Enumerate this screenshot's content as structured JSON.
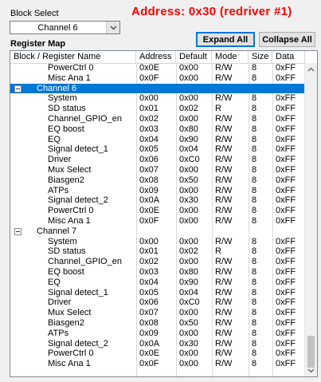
{
  "block_select": {
    "label": "Block Select",
    "value": "Channel 6"
  },
  "address_title": "Address:  0x30 (redriver #1)",
  "register_map_label": "Register Map",
  "buttons": {
    "expand_all": "Expand All",
    "collapse_all": "Collapse All"
  },
  "columns": [
    "Block / Register Name",
    "Address",
    "Default",
    "Mode",
    "Size",
    "Data"
  ],
  "rows": [
    {
      "name": "PowerCtrl 0",
      "address": "0x0E",
      "default": "0x00",
      "mode": "R/W",
      "size": "8",
      "data": "0xFF",
      "level": 1
    },
    {
      "name": "Misc Ana 1",
      "address": "0x0F",
      "default": "0x00",
      "mode": "R/W",
      "size": "8",
      "data": "0xFF",
      "level": 1
    },
    {
      "name": "Channel 6",
      "level": 0,
      "selected": true
    },
    {
      "name": "System",
      "address": "0x00",
      "default": "0x00",
      "mode": "R/W",
      "size": "8",
      "data": "0xFF",
      "level": 1
    },
    {
      "name": "SD status",
      "address": "0x01",
      "default": "0x02",
      "mode": "R",
      "size": "8",
      "data": "0xFF",
      "level": 1
    },
    {
      "name": "Channel_GPIO_en",
      "address": "0x02",
      "default": "0x00",
      "mode": "R/W",
      "size": "8",
      "data": "0xFF",
      "level": 1
    },
    {
      "name": "EQ boost",
      "address": "0x03",
      "default": "0x80",
      "mode": "R/W",
      "size": "8",
      "data": "0xFF",
      "level": 1
    },
    {
      "name": "EQ",
      "address": "0x04",
      "default": "0x90",
      "mode": "R/W",
      "size": "8",
      "data": "0xFF",
      "level": 1
    },
    {
      "name": "Signal detect_1",
      "address": "0x05",
      "default": "0x04",
      "mode": "R/W",
      "size": "8",
      "data": "0xFF",
      "level": 1
    },
    {
      "name": "Driver",
      "address": "0x06",
      "default": "0xC0",
      "mode": "R/W",
      "size": "8",
      "data": "0xFF",
      "level": 1
    },
    {
      "name": "Mux Select",
      "address": "0x07",
      "default": "0x00",
      "mode": "R/W",
      "size": "8",
      "data": "0xFF",
      "level": 1
    },
    {
      "name": "Biasgen2",
      "address": "0x08",
      "default": "0x50",
      "mode": "R/W",
      "size": "8",
      "data": "0xFF",
      "level": 1
    },
    {
      "name": "ATPs",
      "address": "0x09",
      "default": "0x00",
      "mode": "R/W",
      "size": "8",
      "data": "0xFF",
      "level": 1
    },
    {
      "name": "Signal detect_2",
      "address": "0x0A",
      "default": "0x30",
      "mode": "R/W",
      "size": "8",
      "data": "0xFF",
      "level": 1
    },
    {
      "name": "PowerCtrl 0",
      "address": "0x0E",
      "default": "0x00",
      "mode": "R/W",
      "size": "8",
      "data": "0xFF",
      "level": 1
    },
    {
      "name": "Misc Ana 1",
      "address": "0x0F",
      "default": "0x00",
      "mode": "R/W",
      "size": "8",
      "data": "0xFF",
      "level": 1
    },
    {
      "name": "Channel 7",
      "level": 0
    },
    {
      "name": "System",
      "address": "0x00",
      "default": "0x00",
      "mode": "R/W",
      "size": "8",
      "data": "0xFF",
      "level": 1
    },
    {
      "name": "SD status",
      "address": "0x01",
      "default": "0x02",
      "mode": "R",
      "size": "8",
      "data": "0xFF",
      "level": 1
    },
    {
      "name": "Channel_GPIO_en",
      "address": "0x02",
      "default": "0x00",
      "mode": "R/W",
      "size": "8",
      "data": "0xFF",
      "level": 1
    },
    {
      "name": "EQ boost",
      "address": "0x03",
      "default": "0x80",
      "mode": "R/W",
      "size": "8",
      "data": "0xFF",
      "level": 1
    },
    {
      "name": "EQ",
      "address": "0x04",
      "default": "0x90",
      "mode": "R/W",
      "size": "8",
      "data": "0xFF",
      "level": 1
    },
    {
      "name": "Signal detect_1",
      "address": "0x05",
      "default": "0x04",
      "mode": "R/W",
      "size": "8",
      "data": "0xFF",
      "level": 1
    },
    {
      "name": "Driver",
      "address": "0x06",
      "default": "0xC0",
      "mode": "R/W",
      "size": "8",
      "data": "0xFF",
      "level": 1
    },
    {
      "name": "Mux Select",
      "address": "0x07",
      "default": "0x00",
      "mode": "R/W",
      "size": "8",
      "data": "0xFF",
      "level": 1
    },
    {
      "name": "Biasgen2",
      "address": "0x08",
      "default": "0x50",
      "mode": "R/W",
      "size": "8",
      "data": "0xFF",
      "level": 1
    },
    {
      "name": "ATPs",
      "address": "0x09",
      "default": "0x00",
      "mode": "R/W",
      "size": "8",
      "data": "0xFF",
      "level": 1
    },
    {
      "name": "Signal detect_2",
      "address": "0x0A",
      "default": "0x30",
      "mode": "R/W",
      "size": "8",
      "data": "0xFF",
      "level": 1
    },
    {
      "name": "PowerCtrl 0",
      "address": "0x0E",
      "default": "0x00",
      "mode": "R/W",
      "size": "8",
      "data": "0xFF",
      "level": 1
    },
    {
      "name": "Misc Ana 1",
      "address": "0x0F",
      "default": "0x00",
      "mode": "R/W",
      "size": "8",
      "data": "0xFF",
      "level": 1
    }
  ],
  "icons": {
    "dropdown": "chevron-down-icon",
    "collapse_toggle": "minus-box-icon",
    "scroll_up": "arrow-up-icon",
    "scroll_down": "arrow-down-icon"
  },
  "colors": {
    "selection": "#0078d7",
    "address_text": "#ff0000"
  }
}
